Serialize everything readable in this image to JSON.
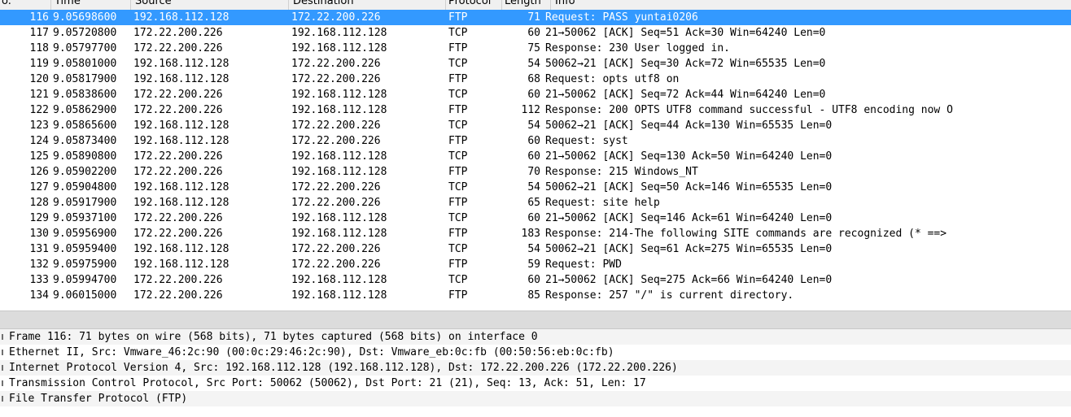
{
  "columns": {
    "no": "o.",
    "time": "Time",
    "source": "Source",
    "destination": "Destination",
    "protocol": "Protocol",
    "length": "Length",
    "info": "Info"
  },
  "packets": [
    {
      "no": "116",
      "time": "9.05698600",
      "src": "192.168.112.128",
      "dst": "172.22.200.226",
      "proto": "FTP",
      "len": "71",
      "info": "Request: PASS yuntai0206"
    },
    {
      "no": "117",
      "time": "9.05720800",
      "src": "172.22.200.226",
      "dst": "192.168.112.128",
      "proto": "TCP",
      "len": "60",
      "info": "21→50062 [ACK] Seq=51 Ack=30 Win=64240 Len=0"
    },
    {
      "no": "118",
      "time": "9.05797700",
      "src": "172.22.200.226",
      "dst": "192.168.112.128",
      "proto": "FTP",
      "len": "75",
      "info": "Response: 230 User logged in."
    },
    {
      "no": "119",
      "time": "9.05801000",
      "src": "192.168.112.128",
      "dst": "172.22.200.226",
      "proto": "TCP",
      "len": "54",
      "info": "50062→21 [ACK] Seq=30 Ack=72 Win=65535 Len=0"
    },
    {
      "no": "120",
      "time": "9.05817900",
      "src": "192.168.112.128",
      "dst": "172.22.200.226",
      "proto": "FTP",
      "len": "68",
      "info": "Request: opts utf8 on"
    },
    {
      "no": "121",
      "time": "9.05838600",
      "src": "172.22.200.226",
      "dst": "192.168.112.128",
      "proto": "TCP",
      "len": "60",
      "info": "21→50062 [ACK] Seq=72 Ack=44 Win=64240 Len=0"
    },
    {
      "no": "122",
      "time": "9.05862900",
      "src": "172.22.200.226",
      "dst": "192.168.112.128",
      "proto": "FTP",
      "len": "112",
      "info": "Response: 200 OPTS UTF8 command successful - UTF8 encoding now O"
    },
    {
      "no": "123",
      "time": "9.05865600",
      "src": "192.168.112.128",
      "dst": "172.22.200.226",
      "proto": "TCP",
      "len": "54",
      "info": "50062→21 [ACK] Seq=44 Ack=130 Win=65535 Len=0"
    },
    {
      "no": "124",
      "time": "9.05873400",
      "src": "192.168.112.128",
      "dst": "172.22.200.226",
      "proto": "FTP",
      "len": "60",
      "info": "Request: syst"
    },
    {
      "no": "125",
      "time": "9.05890800",
      "src": "172.22.200.226",
      "dst": "192.168.112.128",
      "proto": "TCP",
      "len": "60",
      "info": "21→50062 [ACK] Seq=130 Ack=50 Win=64240 Len=0"
    },
    {
      "no": "126",
      "time": "9.05902200",
      "src": "172.22.200.226",
      "dst": "192.168.112.128",
      "proto": "FTP",
      "len": "70",
      "info": "Response: 215 Windows_NT"
    },
    {
      "no": "127",
      "time": "9.05904800",
      "src": "192.168.112.128",
      "dst": "172.22.200.226",
      "proto": "TCP",
      "len": "54",
      "info": "50062→21 [ACK] Seq=50 Ack=146 Win=65535 Len=0"
    },
    {
      "no": "128",
      "time": "9.05917900",
      "src": "192.168.112.128",
      "dst": "172.22.200.226",
      "proto": "FTP",
      "len": "65",
      "info": "Request: site help"
    },
    {
      "no": "129",
      "time": "9.05937100",
      "src": "172.22.200.226",
      "dst": "192.168.112.128",
      "proto": "TCP",
      "len": "60",
      "info": "21→50062 [ACK] Seq=146 Ack=61 Win=64240 Len=0"
    },
    {
      "no": "130",
      "time": "9.05956900",
      "src": "172.22.200.226",
      "dst": "192.168.112.128",
      "proto": "FTP",
      "len": "183",
      "info": "Response: 214-The following SITE commands are recognized (* ==>"
    },
    {
      "no": "131",
      "time": "9.05959400",
      "src": "192.168.112.128",
      "dst": "172.22.200.226",
      "proto": "TCP",
      "len": "54",
      "info": "50062→21 [ACK] Seq=61 Ack=275 Win=65535 Len=0"
    },
    {
      "no": "132",
      "time": "9.05975900",
      "src": "192.168.112.128",
      "dst": "172.22.200.226",
      "proto": "FTP",
      "len": "59",
      "info": "Request: PWD"
    },
    {
      "no": "133",
      "time": "9.05994700",
      "src": "172.22.200.226",
      "dst": "192.168.112.128",
      "proto": "TCP",
      "len": "60",
      "info": "21→50062 [ACK] Seq=275 Ack=66 Win=64240 Len=0"
    },
    {
      "no": "134",
      "time": "9.06015000",
      "src": "172.22.200.226",
      "dst": "192.168.112.128",
      "proto": "FTP",
      "len": "85",
      "info": "Response: 257 \"/\" is current directory."
    }
  ],
  "selected_packet": "116",
  "details": [
    "Frame 116: 71 bytes on wire (568 bits), 71 bytes captured (568 bits) on interface 0",
    "Ethernet II, Src: Vmware_46:2c:90 (00:0c:29:46:2c:90), Dst: Vmware_eb:0c:fb (00:50:56:eb:0c:fb)",
    "Internet Protocol Version 4, Src: 192.168.112.128 (192.168.112.128), Dst: 172.22.200.226 (172.22.200.226)",
    "Transmission Control Protocol, Src Port: 50062 (50062), Dst Port: 21 (21), Seq: 13, Ack: 51, Len: 17",
    "File Transfer Protocol (FTP)"
  ],
  "colors": {
    "selection": "#3399ff",
    "header_bg": "#f0f0f0",
    "scrollbar_bg": "#dcdcdc"
  }
}
